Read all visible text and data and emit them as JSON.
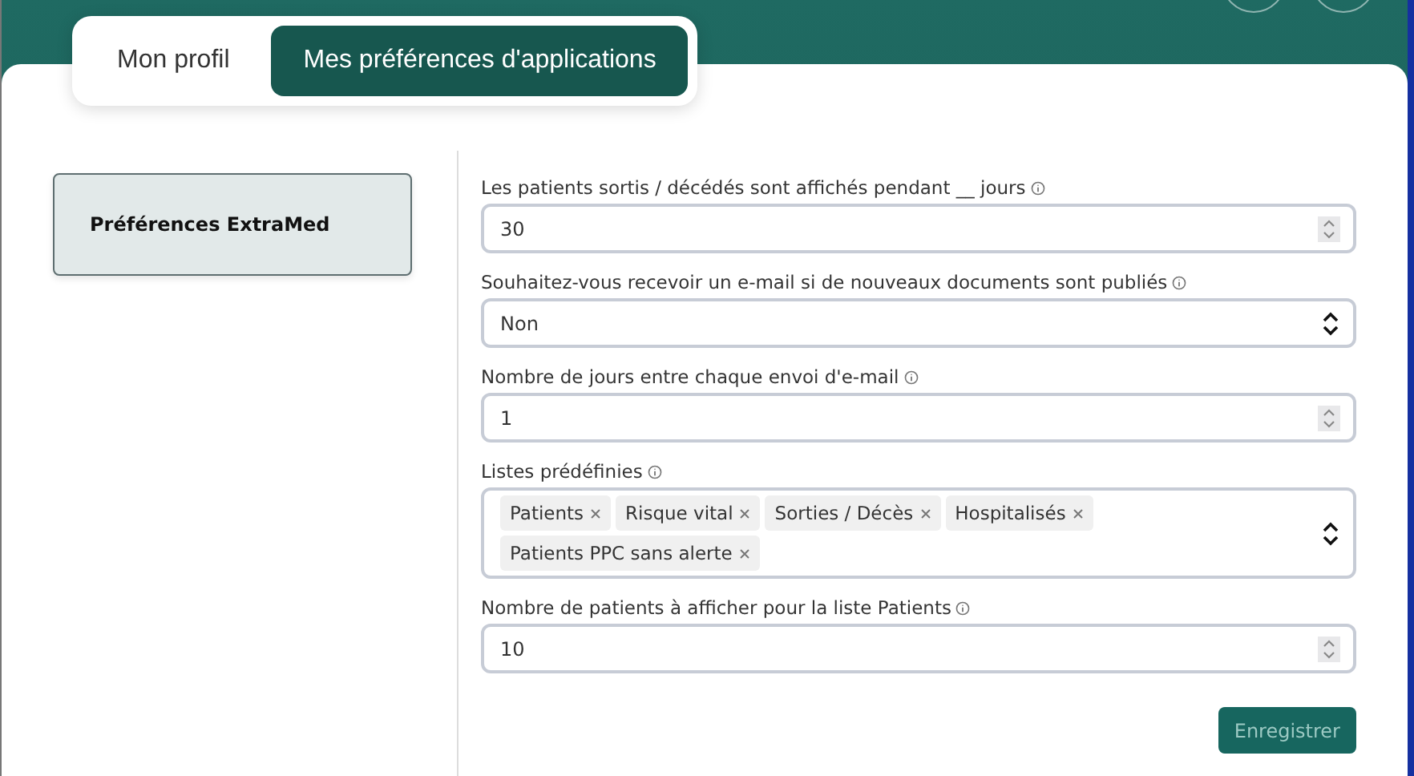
{
  "tabs": [
    {
      "label": "Mon profil",
      "selected": false
    },
    {
      "label": "Mes préférences d'applications",
      "selected": true
    }
  ],
  "sidebar": {
    "items": [
      {
        "label": "Préférences ExtraMed",
        "selected": true
      }
    ]
  },
  "fields": [
    {
      "kind": "number",
      "label": "Les patients sortis / décédés sont affichés pendant __ jours",
      "value": "30"
    },
    {
      "kind": "select",
      "label": "Souhaitez-vous recevoir un e-mail si de nouveaux documents sont publiés",
      "value": "Non"
    },
    {
      "kind": "number",
      "label": "Nombre de jours entre chaque envoi d'e-mail",
      "value": "1"
    },
    {
      "kind": "tags",
      "label": "Listes prédéfinies",
      "tags": [
        "Patients",
        "Risque vital",
        "Sorties / Décès",
        "Hospitalisés",
        "Patients PPC sans alerte"
      ]
    },
    {
      "kind": "number",
      "label": "Nombre de patients à afficher pour la liste Patients",
      "value": "10"
    }
  ],
  "save_button": {
    "label": "Enregistrer",
    "disabled": true
  }
}
